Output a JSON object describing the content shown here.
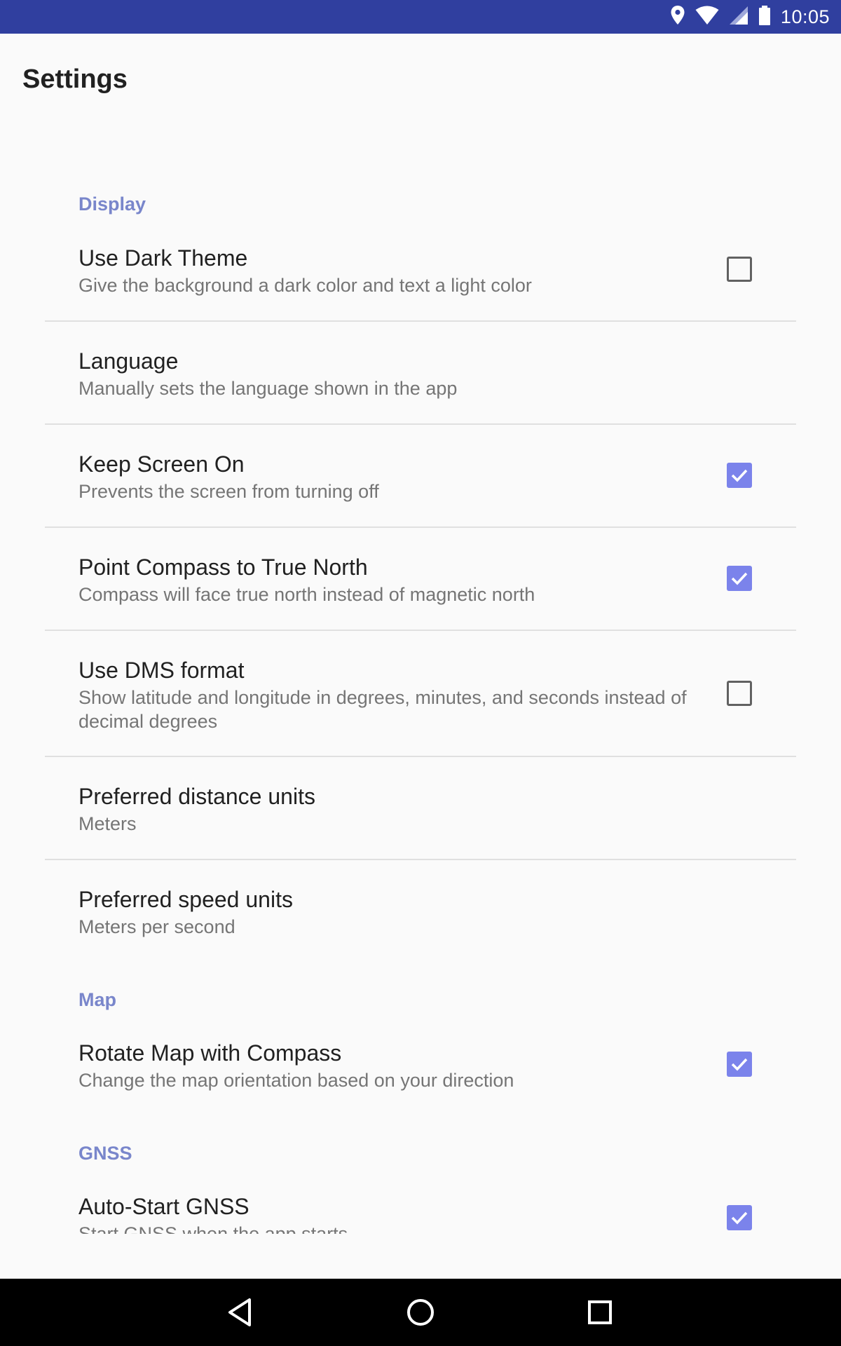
{
  "status_bar": {
    "time": "10:05",
    "icons": [
      "location-icon",
      "wifi-icon",
      "signal-icon",
      "battery-icon"
    ]
  },
  "app_bar": {
    "title": "Settings"
  },
  "colors": {
    "status_bar": "#303f9f",
    "accent": "#7986cb",
    "checkbox_checked": "#7b83eb",
    "background": "#fafafa"
  },
  "categories": {
    "display": "Display",
    "map": "Map",
    "gnss": "GNSS"
  },
  "items": [
    {
      "title": "Use Dark Theme",
      "summary": "Give the background a dark color and text a light color",
      "checked": false
    },
    {
      "title": "Language",
      "summary": "Manually sets the language shown in the app"
    },
    {
      "title": "Keep Screen On",
      "summary": "Prevents the screen from turning off",
      "checked": true
    },
    {
      "title": "Point Compass to True North",
      "summary": "Compass will face true north instead of magnetic north",
      "checked": true
    },
    {
      "title": "Use DMS format",
      "summary": "Show latitude and longitude in degrees, minutes, and seconds instead of decimal degrees",
      "checked": false
    },
    {
      "title": "Preferred distance units",
      "summary": "Meters"
    },
    {
      "title": "Preferred speed units",
      "summary": "Meters per second"
    },
    {
      "title": "Rotate Map with Compass",
      "summary": "Change the map orientation based on your direction",
      "checked": true
    },
    {
      "title": "Auto-Start GNSS",
      "summary": "Start GNSS when the app starts",
      "checked": true
    }
  ],
  "nav_bar": {
    "buttons": [
      "back-icon",
      "home-icon",
      "recents-icon"
    ]
  }
}
